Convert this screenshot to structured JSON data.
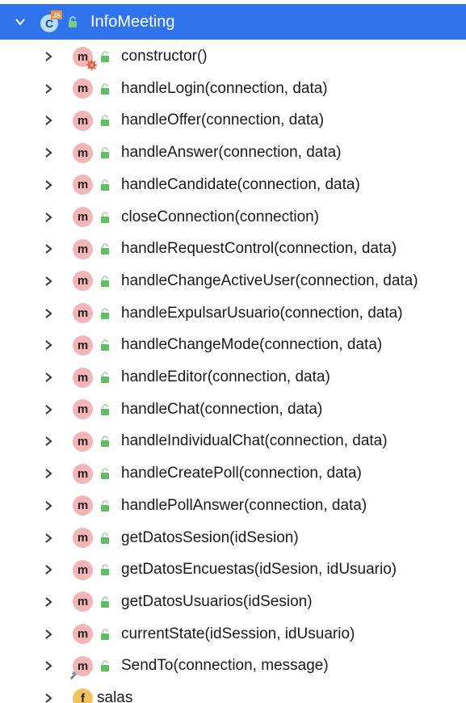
{
  "root": {
    "label": "InfoMeeting",
    "badge": "JS",
    "icon": "class-icon",
    "expanded": true,
    "selection_color": "#2f74ec"
  },
  "members": [
    {
      "label": "constructor()",
      "icon": "method-constructor-icon"
    },
    {
      "label": "handleLogin(connection, data)",
      "icon": "method-icon"
    },
    {
      "label": "handleOffer(connection, data)",
      "icon": "method-icon"
    },
    {
      "label": "handleAnswer(connection, data)",
      "icon": "method-icon"
    },
    {
      "label": "handleCandidate(connection, data)",
      "icon": "method-icon"
    },
    {
      "label": "closeConnection(connection)",
      "icon": "method-icon"
    },
    {
      "label": "handleRequestControl(connection, data)",
      "icon": "method-icon"
    },
    {
      "label": "handleChangeActiveUser(connection, data)",
      "icon": "method-icon"
    },
    {
      "label": "handleExpulsarUsuario(connection, data)",
      "icon": "method-icon"
    },
    {
      "label": "handleChangeMode(connection, data)",
      "icon": "method-icon"
    },
    {
      "label": "handleEditor(connection, data)",
      "icon": "method-icon"
    },
    {
      "label": "handleChat(connection, data)",
      "icon": "method-icon"
    },
    {
      "label": "handleIndividualChat(connection, data)",
      "icon": "method-icon"
    },
    {
      "label": "handleCreatePoll(connection, data)",
      "icon": "method-icon"
    },
    {
      "label": "handlePollAnswer(connection, data)",
      "icon": "method-icon"
    },
    {
      "label": "getDatosSesion(idSesion)",
      "icon": "method-icon"
    },
    {
      "label": "getDatosEncuestas(idSesion, idUsuario)",
      "icon": "method-icon"
    },
    {
      "label": "getDatosUsuarios(idSesion)",
      "icon": "method-icon"
    },
    {
      "label": "currentState(idSession, idUsuario)",
      "icon": "method-icon"
    },
    {
      "label": "SendTo(connection, message)",
      "icon": "method-implementing-icon"
    },
    {
      "label": "salas",
      "icon": "field-icon"
    }
  ],
  "icon_letters": {
    "method": "m",
    "field": "f"
  },
  "colors": {
    "method_bg": "#f3b5b5",
    "field_bg": "#f4c25a",
    "lock_green": "#4caf50",
    "text": "#1a1a1a"
  }
}
